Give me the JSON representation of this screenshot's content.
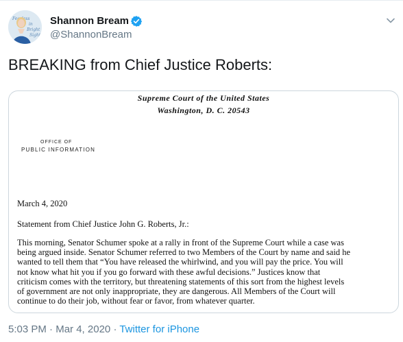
{
  "author": {
    "display_name": "Shannon Bream",
    "handle": "@ShannonBream",
    "verified": true,
    "verified_icon": "verified-badge-icon",
    "avatar_lettering": "Fearless in Bright Sight"
  },
  "tweet": {
    "text": "BREAKING from Chief Justice Roberts:"
  },
  "document": {
    "court_name": "Supreme Court of the United States",
    "court_city": "Washington, D. C. 20543",
    "office_line1": "OFFICE OF",
    "office_line2": "PUBLIC INFORMATION",
    "date": "March 4, 2020",
    "statement_heading": "Statement from Chief Justice John G. Roberts, Jr.:",
    "body_lines": [
      "This morning, Senator Schumer spoke at a rally in front of the Supreme Court while a case was",
      "being argued inside. Senator Schumer referred to two Members of the Court by name and said he",
      "wanted to tell them that “You have released the whirlwind, and you will pay the price. You will",
      "not know what hit you if you go forward with these awful decisions.” Justices know that",
      "criticism comes with the territory, but threatening statements of this sort from the highest levels",
      "of government are not only inappropriate, they are dangerous. All Members of the Court will",
      "continue to do their job, without fear or favor, from whatever quarter."
    ]
  },
  "meta": {
    "time": "5:03 PM",
    "separator": "·",
    "date": "Mar 4, 2020",
    "source": "Twitter for iPhone"
  },
  "colors": {
    "accent": "#1b95e0",
    "verified": "#1da1f2",
    "secondary_text": "#657786",
    "border": "#ccd6dd"
  }
}
